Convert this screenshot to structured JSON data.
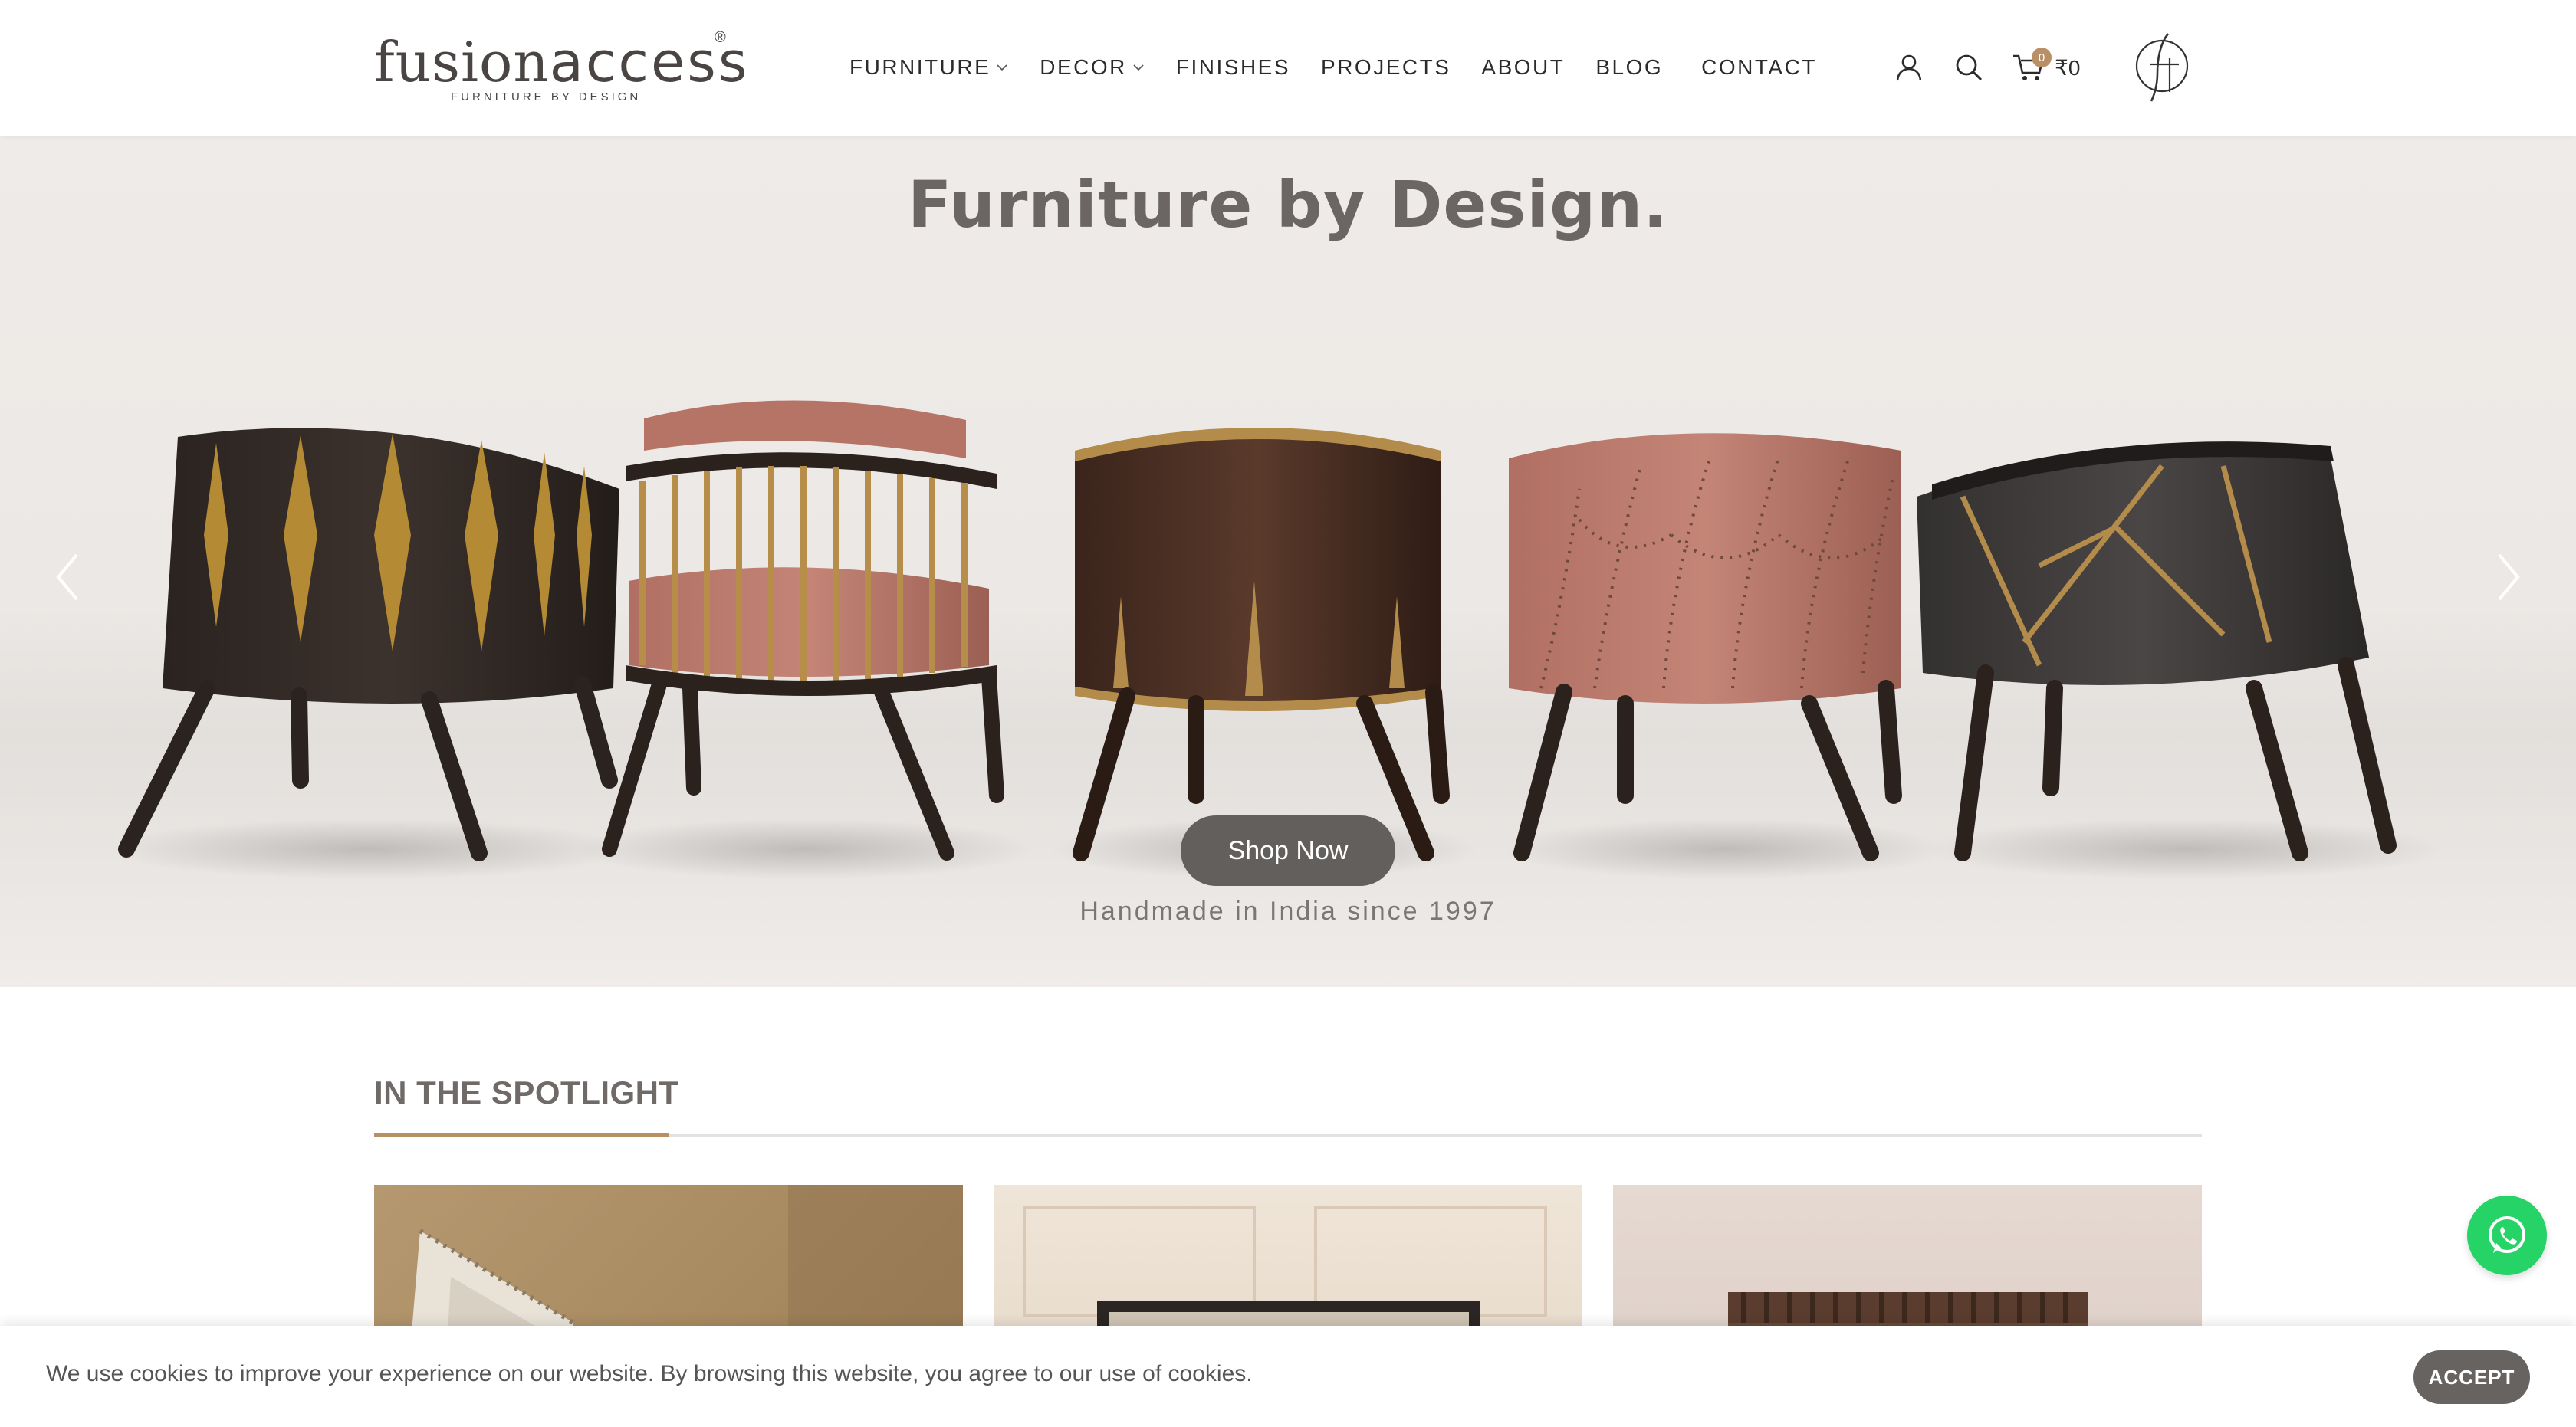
{
  "brand": {
    "name_part1": "fusion",
    "name_part2": "access",
    "registered": "®",
    "tagline": "FURNITURE BY DESIGN"
  },
  "nav": {
    "items": [
      {
        "label": "FURNITURE",
        "has_dropdown": true
      },
      {
        "label": "DECOR",
        "has_dropdown": true
      },
      {
        "label": "FINISHES",
        "has_dropdown": false
      },
      {
        "label": "PROJECTS",
        "has_dropdown": false
      },
      {
        "label": "ABOUT",
        "has_dropdown": false
      },
      {
        "label": "BLOG",
        "has_dropdown": false
      },
      {
        "label": "CONTACT",
        "has_dropdown": false
      }
    ]
  },
  "header_icons": {
    "account_icon": "user-icon",
    "search_icon": "search-icon",
    "cart_icon": "cart-icon",
    "cart_count": "0",
    "cart_total": "₹0",
    "brand_mark_icon": "fa-monogram-icon"
  },
  "hero": {
    "title": "Furniture by Design.",
    "cta_label": "Shop Now",
    "subtitle": "Handmade in India since 1997",
    "prev_icon": "chevron-left-icon",
    "next_icon": "chevron-right-icon"
  },
  "spotlight": {
    "title": "IN THE SPOTLIGHT"
  },
  "whatsapp": {
    "icon": "whatsapp-icon"
  },
  "cookie_bar": {
    "message": "We use cookies to improve your experience on our website. By browsing this website, you agree to our use of cookies.",
    "accept_label": "ACCEPT"
  },
  "colors": {
    "accent": "#b98f65",
    "button_dark": "#625f5d",
    "text_dark": "#2b2b2b",
    "whatsapp_green": "#25d366"
  }
}
